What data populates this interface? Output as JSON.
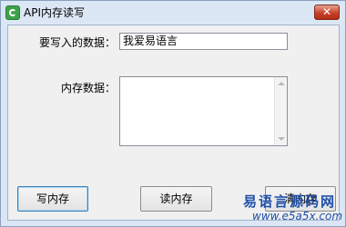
{
  "window": {
    "title": "API内存读写",
    "close_glyph": "✕"
  },
  "form": {
    "data_to_write_label": "要写入的数据：",
    "data_to_write_value": "我爱易语言",
    "memory_data_label": "内存数据：",
    "memory_data_value": ""
  },
  "buttons": {
    "write_label": "写内存",
    "read_label": "读内存",
    "clear_label": "清内存"
  },
  "watermark": {
    "chinese": "易语言源码网",
    "url": "www.e5a5x.com"
  }
}
